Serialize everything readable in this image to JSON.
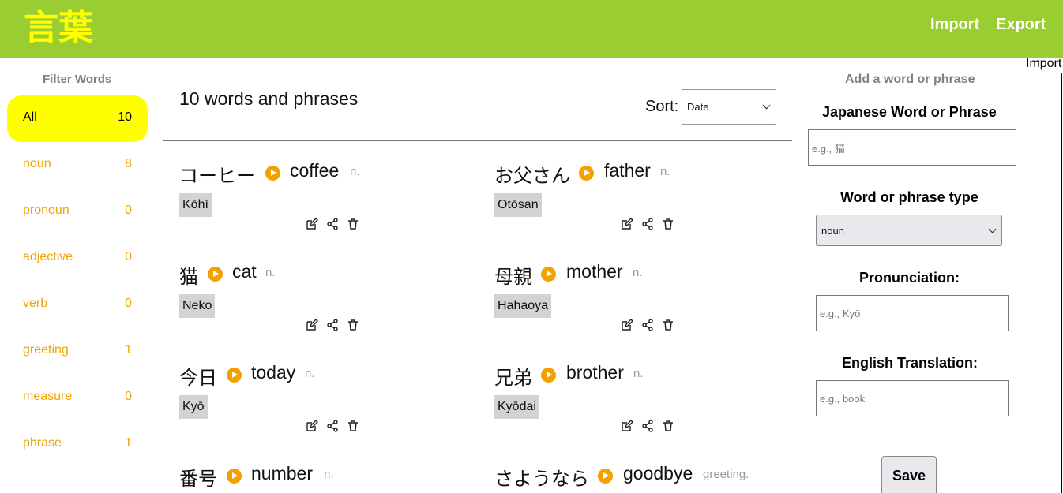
{
  "header": {
    "logo": "言葉",
    "import_label": "Import",
    "export_label": "Export",
    "stray_import": "Import",
    "bg_color": "#9acd32",
    "logo_color": "#ffff00"
  },
  "sidebar": {
    "title": "Filter Words",
    "filters": [
      {
        "label": "All",
        "count": "10",
        "active": true
      },
      {
        "label": "noun",
        "count": "8"
      },
      {
        "label": "pronoun",
        "count": "0"
      },
      {
        "label": "adjective",
        "count": "0"
      },
      {
        "label": "verb",
        "count": "0"
      },
      {
        "label": "greeting",
        "count": "1"
      },
      {
        "label": "measure",
        "count": "0"
      },
      {
        "label": "phrase",
        "count": "1"
      }
    ]
  },
  "main": {
    "count_title": "10 words and phrases",
    "sort_label": "Sort:",
    "sort_value": "Date",
    "cards": [
      {
        "japanese": "コーヒー",
        "english": "coffee",
        "type": "n.",
        "pronunciation": "Kōhī"
      },
      {
        "japanese": "お父さん",
        "english": "father",
        "type": "n.",
        "pronunciation": "Otōsan"
      },
      {
        "japanese": "猫",
        "english": "cat",
        "type": "n.",
        "pronunciation": "Neko"
      },
      {
        "japanese": "母親",
        "english": "mother",
        "type": "n.",
        "pronunciation": "Hahaoya"
      },
      {
        "japanese": "今日",
        "english": "today",
        "type": "n.",
        "pronunciation": "Kyō"
      },
      {
        "japanese": "兄弟",
        "english": "brother",
        "type": "n.",
        "pronunciation": "Kyōdai"
      },
      {
        "japanese": "番号",
        "english": "number",
        "type": "n.",
        "pronunciation": ""
      },
      {
        "japanese": "さようなら",
        "english": "goodbye",
        "type": "greeting.",
        "pronunciation": ""
      }
    ],
    "icons": [
      "edit-icon",
      "share-icon",
      "trash-icon",
      "play-icon"
    ],
    "accent_color": "#f4a000"
  },
  "form": {
    "title": "Add a word or phrase",
    "japanese_label": "Japanese Word or Phrase",
    "japanese_placeholder": "e.g., 猫",
    "type_label": "Word or phrase type",
    "type_value": "noun",
    "pron_label": "Pronunciation:",
    "pron_placeholder": "e.g., Kyō",
    "english_label": "English Translation:",
    "english_placeholder": "e.g., book",
    "save_label": "Save"
  }
}
